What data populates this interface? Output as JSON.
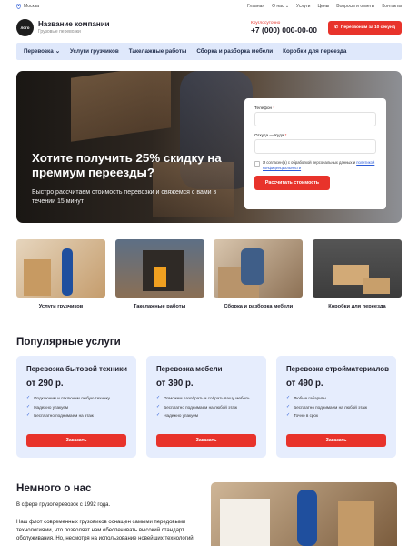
{
  "topbar": {
    "city": "Москва",
    "nav": [
      "Главная",
      "О нас",
      "Услуги",
      "Цены",
      "Вопросы и ответы",
      "Контакты"
    ]
  },
  "header": {
    "logo": "лого",
    "company_name": "Название компании",
    "company_sub": "Грузовые перевозки",
    "phone_label": "Круглосуточно",
    "phone": "+7 (000) 000-00-00",
    "call_button": "Перезвоним за 10 секунд"
  },
  "menu": [
    "Перевозка",
    "Услуги грузчиков",
    "Такелажные работы",
    "Сборка и разборка мебели",
    "Коробки для переезда"
  ],
  "hero": {
    "title": "Хотите получить 25% скидку на премиум переезды?",
    "subtitle": "Быстро рассчитаем стоимость перевозки и свяжемся с вами в течении 15 минут"
  },
  "form": {
    "phone_label": "Телефон",
    "route_label": "Откуда — Куда",
    "required_mark": "*",
    "consent_text": "Я согласен(а) с обработкой персональных данных и",
    "consent_link": "политикой конфиденциальности",
    "submit": "Рассчитать стоимость"
  },
  "categories": [
    "Услуги грузчиков",
    "Такелажные работы",
    "Сборка и разборка мебели",
    "Коробки для переезда"
  ],
  "popular_title": "Популярные услуги",
  "services": [
    {
      "title": "Перевозка бытовой техники",
      "price": "от 290 р.",
      "features": [
        "Подключим и отключим любую технику",
        "Надежно упакуем",
        "Бесплатно поднимаем на этаж"
      ],
      "button": "Заказать"
    },
    {
      "title": "Перевозка мебели",
      "price": "от 390 р.",
      "features": [
        "Поможем разобрать и собрать вашу мебель",
        "Бесплатно поднимаем на любой этаж",
        "Надежно упакуем"
      ],
      "button": "Заказать"
    },
    {
      "title": "Перевозка стройматериалов",
      "price": "от 490 р.",
      "features": [
        "Любые габариты",
        "Бесплатно поднимаем на любой этаж",
        "Точно в срок"
      ],
      "button": "Заказать"
    }
  ],
  "about": {
    "title": "Немного о нас",
    "p1": "В сфере грузоперевозок с 1992 года.",
    "p2": "Наш флот современных грузовиков оснащен самыми передовыми технологиями, что позволяет нам обеспечивать высокий стандарт обслуживания. Но, несмотря на использование новейших технологий,"
  },
  "colors": {
    "accent": "#e8332b",
    "menu_bg": "#dfe8fb",
    "card_bg": "#e6edfd"
  }
}
